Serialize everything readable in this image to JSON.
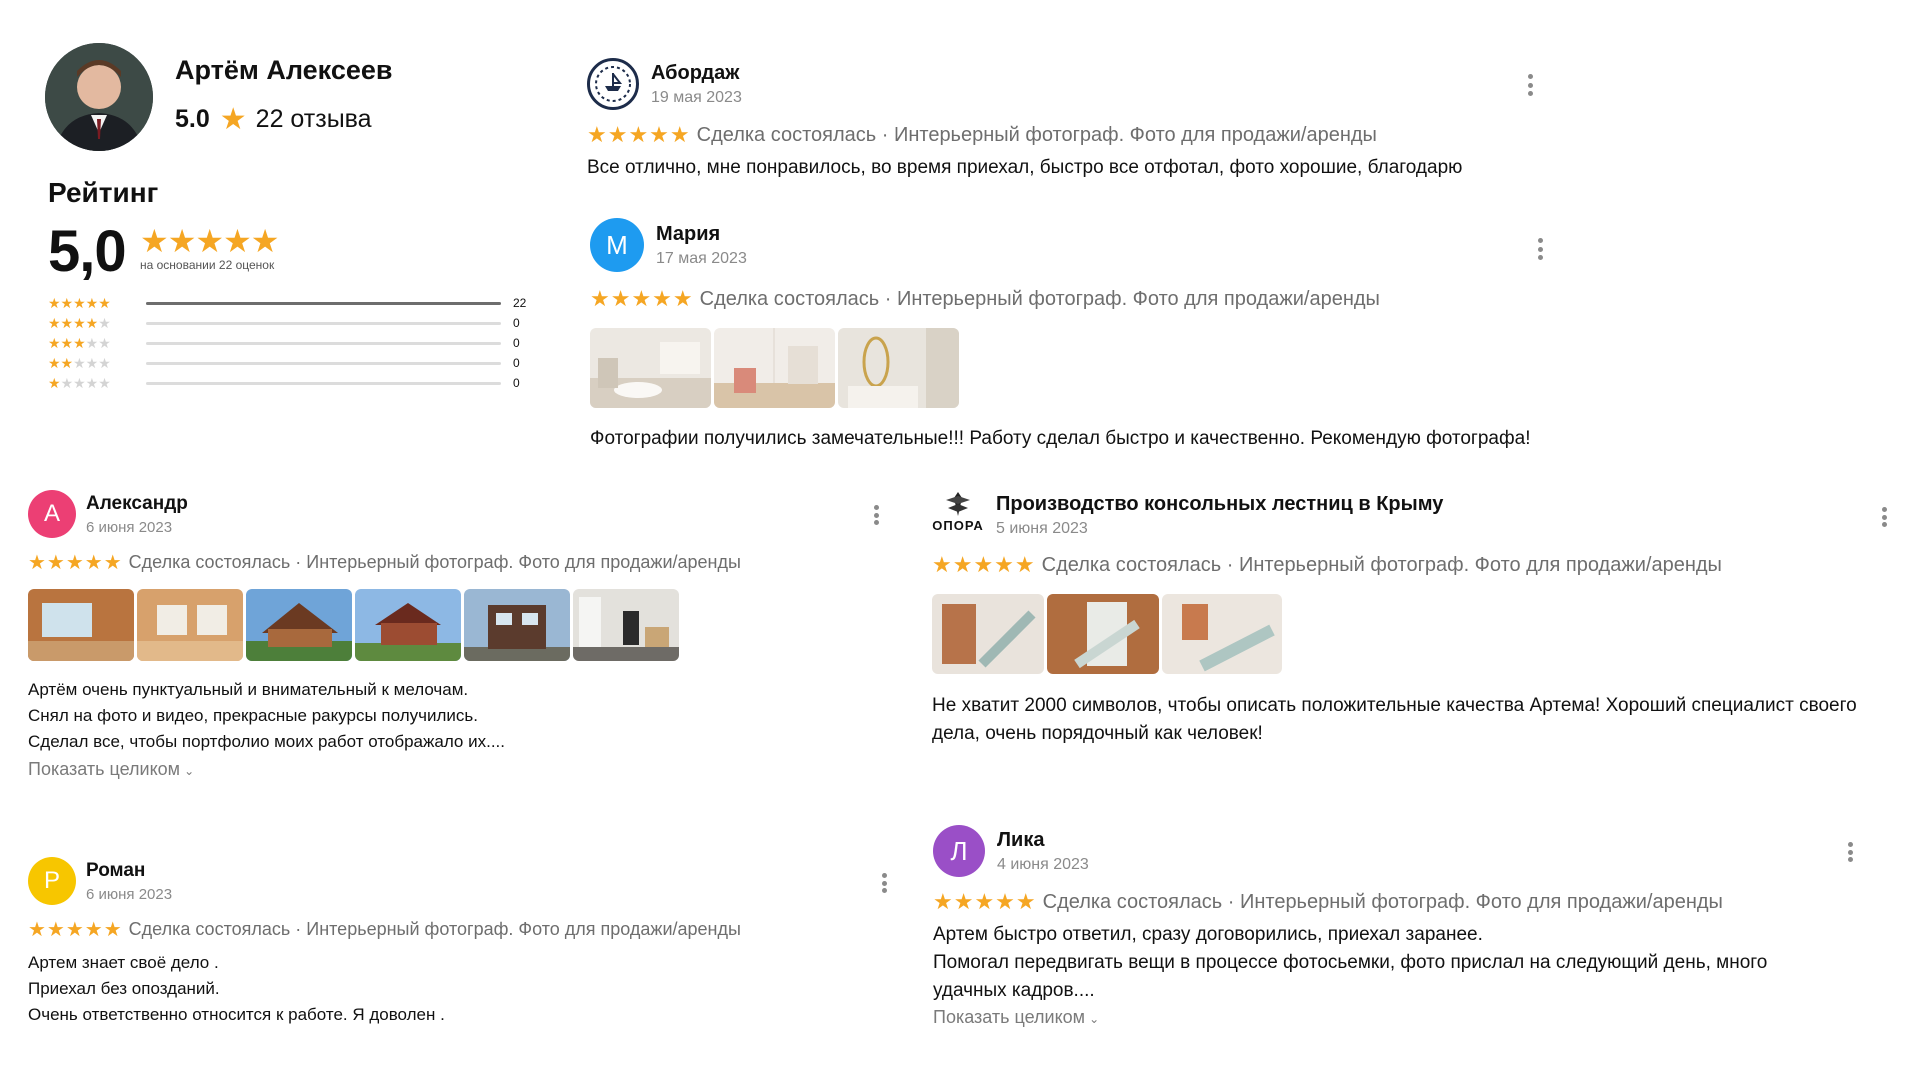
{
  "profile": {
    "name": "Артём Алексеев",
    "rating": "5.0",
    "reviews_count": "22 отзыва"
  },
  "rating_block": {
    "title": "Рейтинг",
    "value": "5,0",
    "based_on": "на основании 22 оценок",
    "rows": [
      {
        "stars": 5,
        "count": "22",
        "fraction": 1.0
      },
      {
        "stars": 4,
        "count": "0",
        "fraction": 0
      },
      {
        "stars": 3,
        "count": "0",
        "fraction": 0
      },
      {
        "stars": 2,
        "count": "0",
        "fraction": 0
      },
      {
        "stars": 1,
        "count": "0",
        "fraction": 0
      }
    ]
  },
  "meta_text": "Сделка состоялась · Интерьерный фотограф. Фото для продажи/аренды",
  "show_more_label": "Показать целиком",
  "reviews": {
    "abordazh": {
      "name": "Абордаж",
      "date": "19 мая 2023",
      "text": "Все отлично, мне понравилось, во время приехал, быстро все отфотал, фото хорошие, благодарю"
    },
    "maria": {
      "initial": "М",
      "name": "Мария",
      "date": "17 мая 2023",
      "text": "Фотографии получились замечательные!!! Работу сделал быстро и качественно. Рекомендую фотографа!"
    },
    "alexandr": {
      "initial": "А",
      "name": "Александр",
      "date": "6 июня 2023",
      "lines": [
        "Артём очень пунктуальный и внимательный к мелочам.",
        "Снял на фото и видео, прекрасные ракурсы получились.",
        "Сделал все, чтобы портфолио моих работ отображало их...."
      ]
    },
    "opora": {
      "name": "Производство консольных лестниц в Крыму",
      "logo_text": "ОПОРА",
      "date": "5 июня 2023",
      "text": "Не хватит 2000 символов, чтобы описать положительные качества Артема! Хороший специалист своего дела, очень порядочный как человек!"
    },
    "roman": {
      "initial": "Р",
      "name": "Роман",
      "date": "6 июня 2023",
      "lines": [
        "Артем знает своё дело .",
        "Приехал без опозданий.",
        "Очень ответственно относится к работе. Я доволен ."
      ]
    },
    "lika": {
      "initial": "Л",
      "name": "Лика",
      "date": "4 июня 2023",
      "lines": [
        "Артем быстро ответил, сразу договорились, приехал заранее.",
        "Помогал передвигать вещи в процессе фотосьемки, фото прислал на следующий день, много удачных кадров...."
      ]
    }
  },
  "colors": {
    "star": "#f5a623",
    "avatar_maria": "#1e9bf0",
    "avatar_alexandr": "#ec3f74",
    "avatar_roman": "#f7c600",
    "avatar_lika": "#9a4fc7"
  }
}
